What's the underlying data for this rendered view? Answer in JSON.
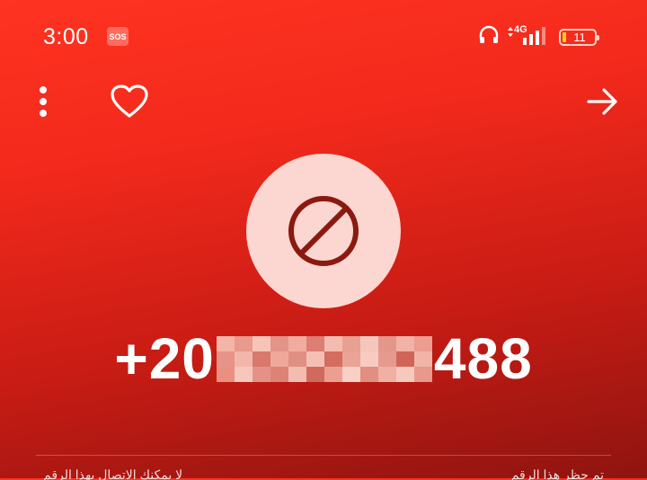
{
  "status_bar": {
    "time": "3:00",
    "sos_label": "SOS",
    "network_label": "4G",
    "battery_level": "11",
    "battery_color": "#ffd21e"
  },
  "toolbar": {
    "more_icon": "more-vertical-icon",
    "favorite_icon": "heart-outline-icon",
    "next_icon": "arrow-right-icon"
  },
  "contact": {
    "avatar_icon": "blocked-icon",
    "avatar_bg": "#fcd6d0",
    "blocked_icon_color": "#8a1a10",
    "number_prefix": "+20",
    "number_suffix": "488",
    "number_redacted": true
  },
  "footer_text": {
    "left": "لا يمكنك الاتصال بهذا الرقم",
    "right": "تم حظر هذا الرقم"
  }
}
